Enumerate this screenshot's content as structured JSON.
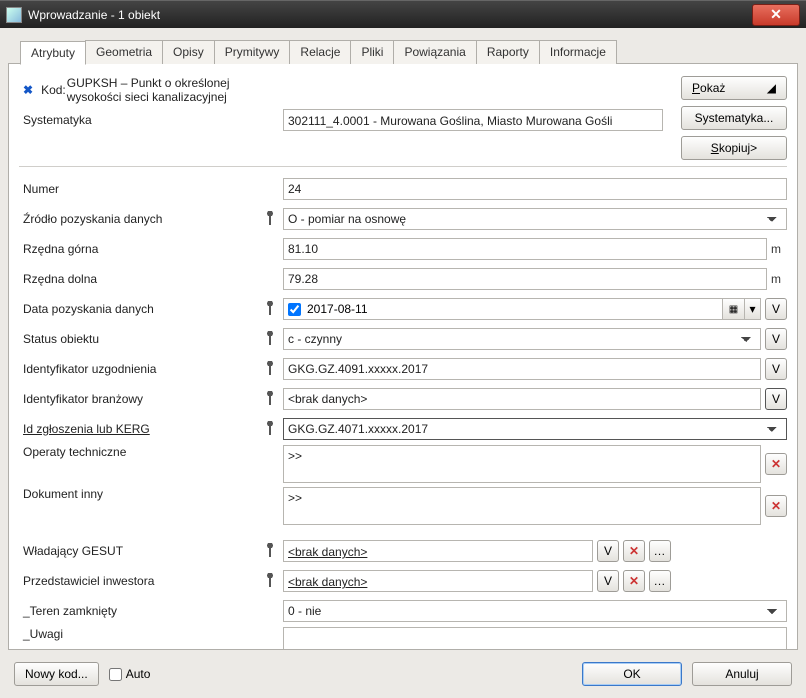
{
  "titlebar": {
    "text": "Wprowadzanie - 1 obiekt"
  },
  "tabs": [
    "Atrybuty",
    "Geometria",
    "Opisy",
    "Prymitywy",
    "Relacje",
    "Pliki",
    "Powiązania",
    "Raporty",
    "Informacje"
  ],
  "side": {
    "pokaz": "Pokaż",
    "systematyka": "Systematyka...",
    "skopiuj": "Skopiuj>"
  },
  "header": {
    "kod_label": "Kod:",
    "kod_value": "GUPKSH – Punkt o określonej wysokości sieci kanalizacyjnej",
    "syst_label": "Systematyka",
    "syst_value": "302111_4.0001 - Murowana Goślina, Miasto Murowana Gośli"
  },
  "fields": {
    "numer": {
      "label": "Numer",
      "value": "24"
    },
    "zrodlo": {
      "label": "Źródło pozyskania danych",
      "value": "O - pomiar na osnowę"
    },
    "rzedna_g": {
      "label": "Rzędna górna",
      "value": "81.10",
      "unit": "m"
    },
    "rzedna_d": {
      "label": "Rzędna dolna",
      "value": "79.28",
      "unit": "m"
    },
    "data_poz": {
      "label": "Data pozyskania danych",
      "value": "2017-08-11"
    },
    "status": {
      "label": "Status obiektu",
      "value": "c - czynny"
    },
    "id_uzg": {
      "label": "Identyfikator uzgodnienia",
      "value": "GKG.GZ.4091.xxxxx.2017"
    },
    "id_branz": {
      "label": "Identyfikator branżowy",
      "value": "<brak danych>"
    },
    "id_zgl": {
      "label": "Id zgłoszenia lub KERG",
      "value": "GKG.GZ.4071.xxxxx.2017"
    },
    "op_tech": {
      "label": "Operaty techniczne",
      "value": ">>"
    },
    "dok_inny": {
      "label": "Dokument inny",
      "value": ">>"
    },
    "wlad": {
      "label": "Władający GESUT",
      "value": "<brak danych>"
    },
    "przed": {
      "label": "Przedstawiciel inwestora",
      "value": "<brak danych>"
    },
    "teren": {
      "label": "_Teren zamknięty",
      "value": "0 - nie"
    },
    "uwagi": {
      "label": "_Uwagi",
      "value": ""
    }
  },
  "footer": {
    "nowy": "Nowy kod...",
    "auto": "Auto",
    "ok": "OK",
    "anuluj": "Anuluj"
  }
}
